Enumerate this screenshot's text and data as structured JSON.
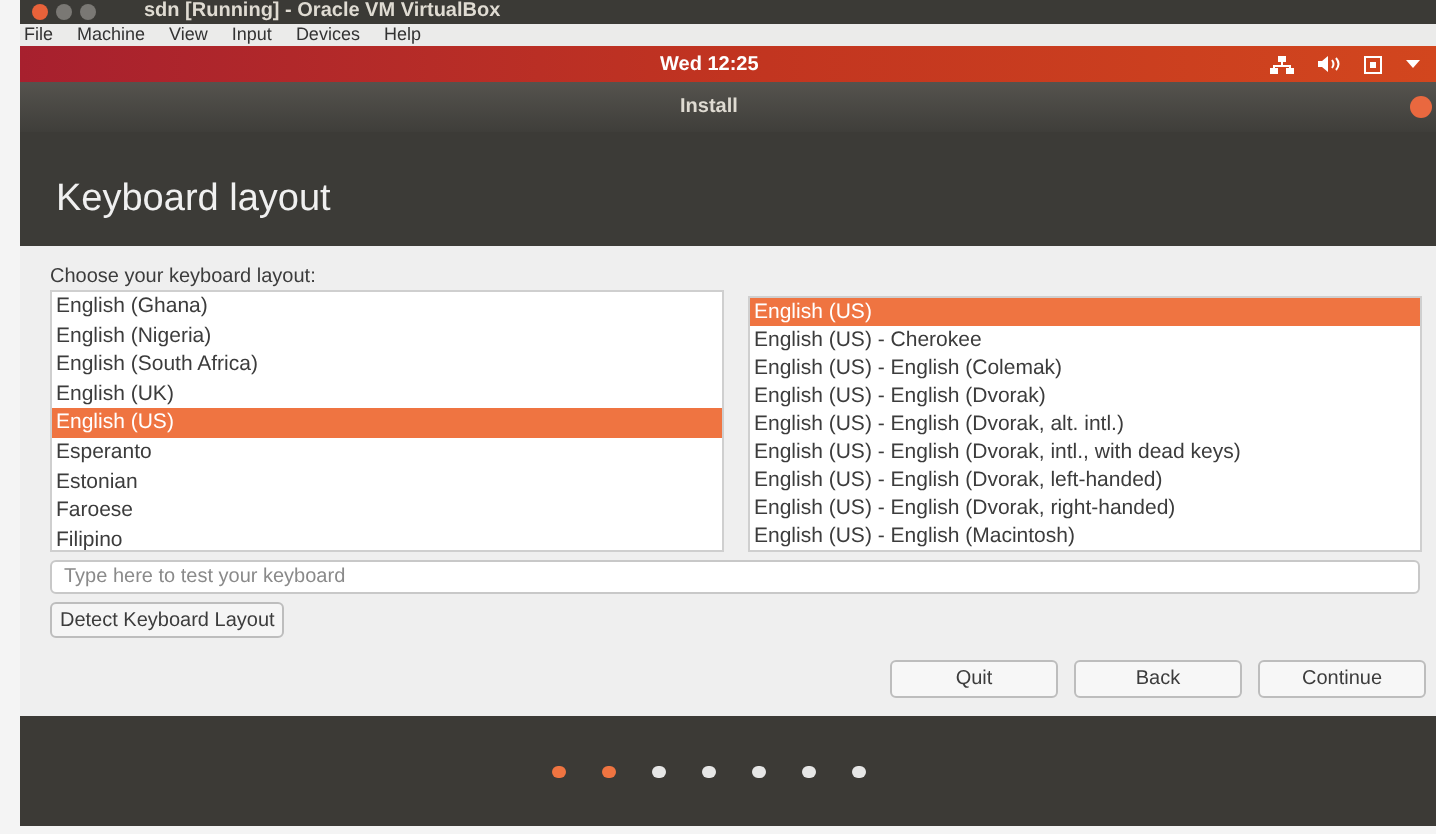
{
  "host_window": {
    "title": "sdn [Running] - Oracle VM VirtualBox"
  },
  "host_menu": [
    "File",
    "Machine",
    "View",
    "Input",
    "Devices",
    "Help"
  ],
  "top_panel": {
    "clock": "Wed 12:25"
  },
  "dialog": {
    "title": "Install",
    "heading": "Keyboard layout"
  },
  "layout_label": "Choose your keyboard layout:",
  "layouts": [
    {
      "label": "English (Ghana)",
      "selected": false
    },
    {
      "label": "English (Nigeria)",
      "selected": false
    },
    {
      "label": "English (South Africa)",
      "selected": false
    },
    {
      "label": "English (UK)",
      "selected": false
    },
    {
      "label": "English (US)",
      "selected": true
    },
    {
      "label": "Esperanto",
      "selected": false
    },
    {
      "label": "Estonian",
      "selected": false
    },
    {
      "label": "Faroese",
      "selected": false
    },
    {
      "label": "Filipino",
      "selected": false
    }
  ],
  "variants": [
    {
      "label": "English (US)",
      "selected": true
    },
    {
      "label": "English (US) - Cherokee",
      "selected": false
    },
    {
      "label": "English (US) - English (Colemak)",
      "selected": false
    },
    {
      "label": "English (US) - English (Dvorak)",
      "selected": false
    },
    {
      "label": "English (US) - English (Dvorak, alt. intl.)",
      "selected": false
    },
    {
      "label": "English (US) - English (Dvorak, intl., with dead keys)",
      "selected": false
    },
    {
      "label": "English (US) - English (Dvorak, left-handed)",
      "selected": false
    },
    {
      "label": "English (US) - English (Dvorak, right-handed)",
      "selected": false
    },
    {
      "label": "English (US) - English (Macintosh)",
      "selected": false
    }
  ],
  "test_field": {
    "placeholder": "Type here to test your keyboard"
  },
  "detect_button": "Detect Keyboard Layout",
  "buttons": [
    "Quit",
    "Back",
    "Continue"
  ],
  "progress_steps": [
    {
      "completed": true
    },
    {
      "completed": true
    },
    {
      "completed": false
    },
    {
      "completed": false
    },
    {
      "completed": false
    },
    {
      "completed": false
    },
    {
      "completed": false
    }
  ]
}
